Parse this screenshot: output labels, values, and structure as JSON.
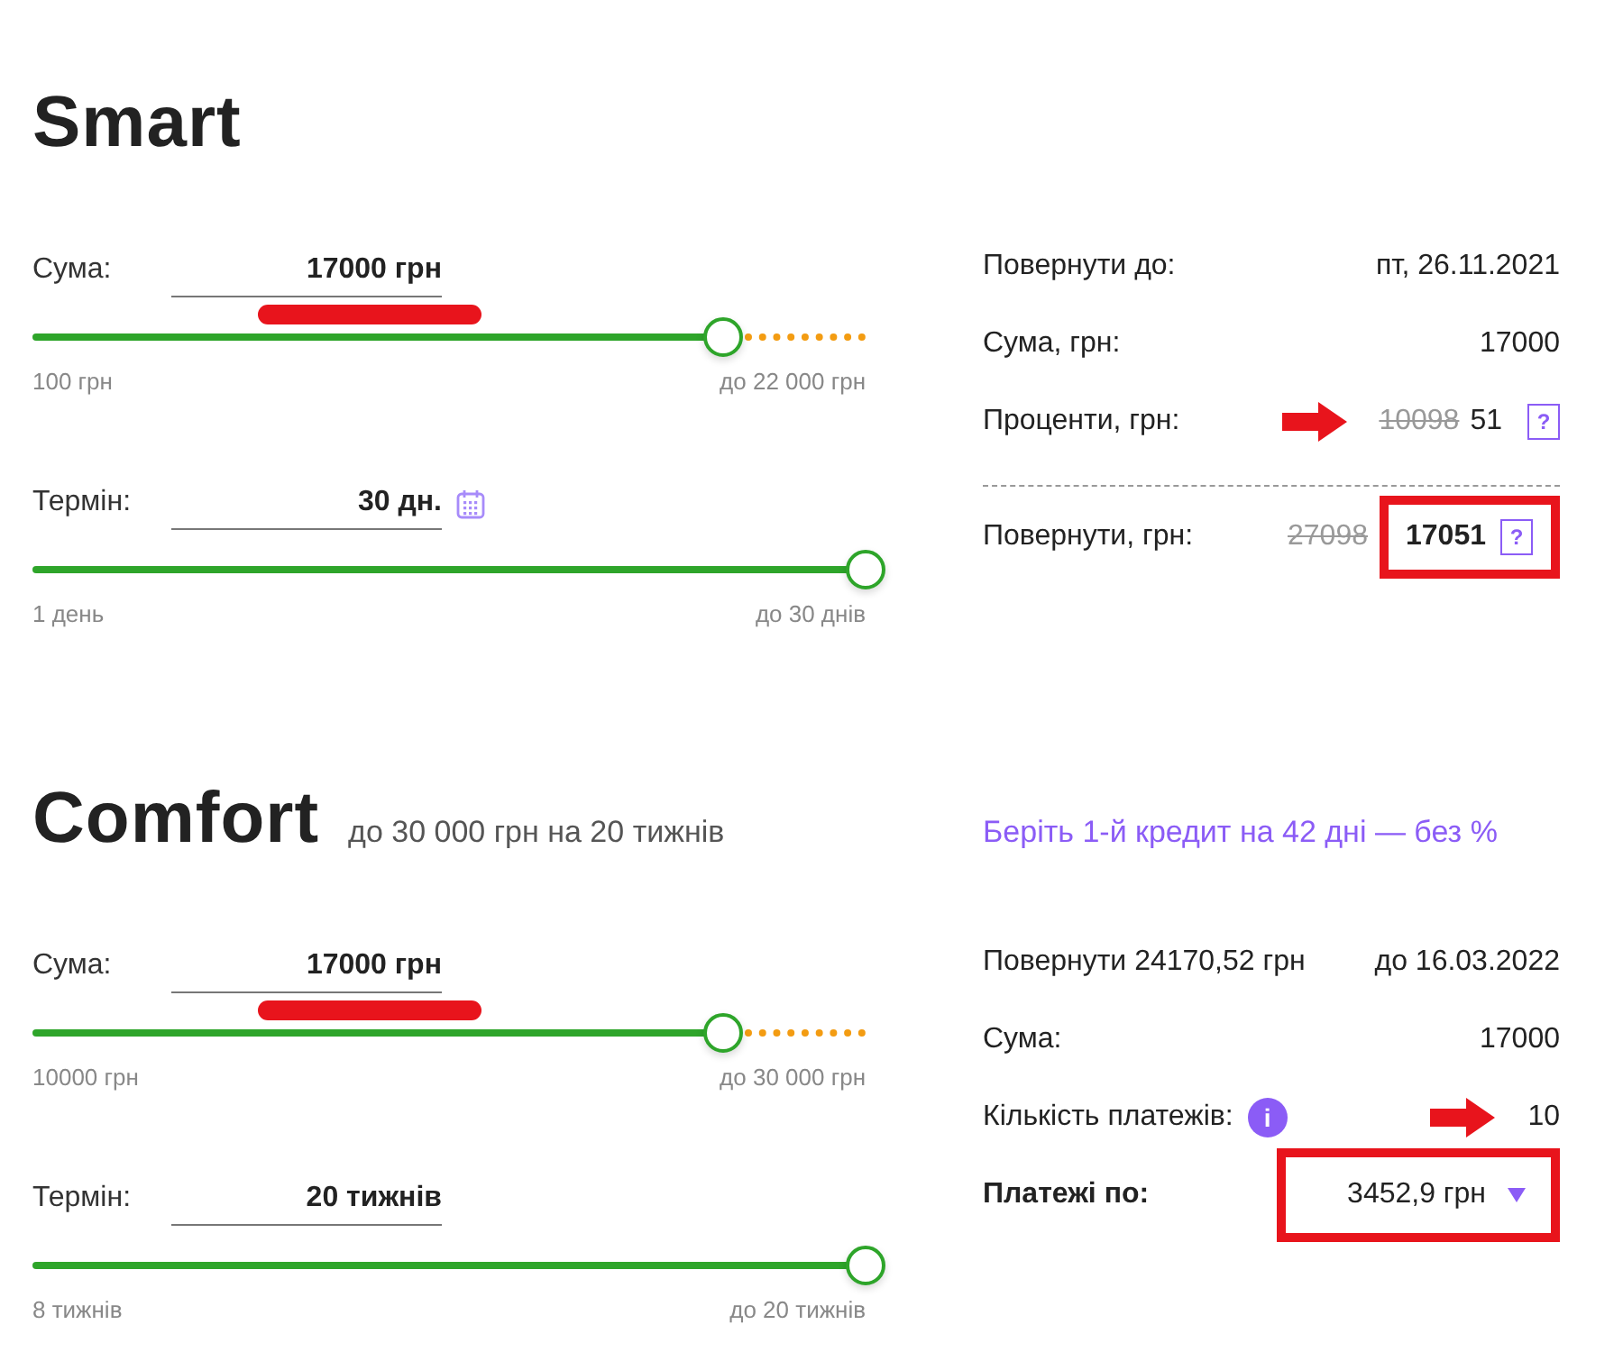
{
  "sections": [
    {
      "title": "Smart",
      "sliders": [
        {
          "label": "Сума:",
          "value": "17000 грн",
          "level": 0.83,
          "min_label": "100 грн",
          "max_label": "до 22 000 грн",
          "calendar": false,
          "marked": true
        },
        {
          "label": "Термін:",
          "value": "30 дн.",
          "level": 1,
          "min_label": "1 день",
          "max_label": "до 30 днів",
          "calendar": true,
          "marked": false
        }
      ],
      "rows": [
        {
          "kind": "row",
          "label": "Повернути до:",
          "value": "пт, 26.11.2021",
          "arrow": false,
          "boxed": false
        },
        {
          "kind": "row",
          "label": "Сума, грн:",
          "value": "17000",
          "arrow": false,
          "boxed": false
        },
        {
          "kind": "row",
          "label": "Проценти, грн:",
          "old_value": "10098",
          "value": "51",
          "help": "?",
          "arrow": true,
          "boxed": false
        },
        {
          "kind": "total",
          "label": "Повернути, грн:",
          "old_value": "27098",
          "value": "17051",
          "help": "?",
          "arrow": false,
          "boxed": true
        }
      ]
    },
    {
      "title": "Comfort",
      "subtitle": "до 30 000 грн на 20 тижнів",
      "promo": "Беріть 1-й кредит на 42 дні — без %",
      "sliders": [
        {
          "label": "Сума:",
          "value": "17000 грн",
          "level": 0.83,
          "min_label": "10000 грн",
          "max_label": "до 30 000 грн",
          "calendar": false,
          "marked": true
        },
        {
          "label": "Термін:",
          "value": "20 тижнів",
          "level": 1,
          "min_label": "8 тижнів",
          "max_label": "до 20 тижнів",
          "calendar": false,
          "marked": false
        }
      ],
      "rows": [
        {
          "kind": "row",
          "label": "Повернути 24170,52 грн",
          "value": "до 16.03.2022",
          "arrow": false,
          "boxed": false
        },
        {
          "kind": "row",
          "label": "Сума:",
          "value": "17000",
          "arrow": false,
          "boxed": false
        },
        {
          "kind": "row",
          "label": "Кількість платежів:",
          "info": "i",
          "value": "10",
          "arrow": true,
          "boxed": false
        },
        {
          "kind": "dropdown",
          "label": "Платежі по:",
          "value": "3452,9 грн",
          "arrow": false,
          "boxed": true
        }
      ]
    }
  ]
}
